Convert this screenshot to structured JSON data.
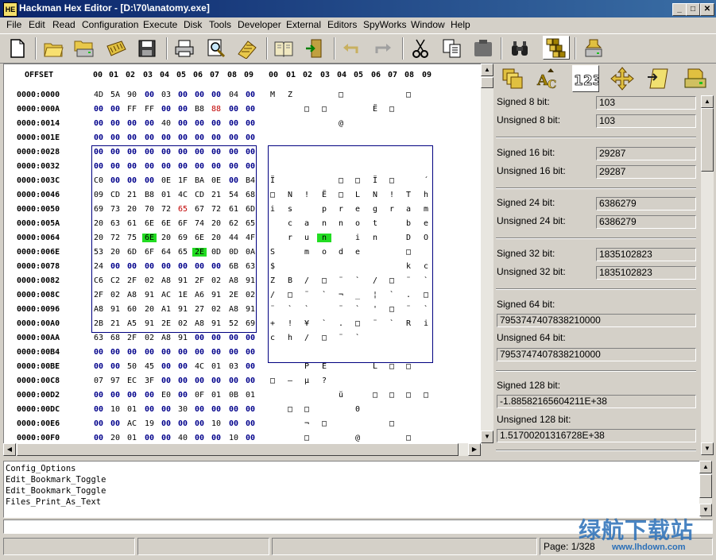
{
  "window": {
    "title": "Hackman Hex Editor - [D:\\70\\anatomy.exe]",
    "app_icon_text": "HE"
  },
  "menu": [
    "File",
    "Edit",
    "Read",
    "Configuration",
    "Execute",
    "Disk",
    "Tools",
    "Developer",
    "External",
    "Editors",
    "SpyWorks",
    "Window",
    "Help"
  ],
  "toolbar": [
    "new-file-icon",
    "open-folder-icon",
    "open-drive-icon",
    "open-memory-icon",
    "save-icon",
    "print-icon",
    "find-icon",
    "calculator-icon",
    "bookmark-book-icon",
    "exit-door-icon",
    "undo-icon",
    "redo-icon",
    "cut-icon",
    "copy-icon",
    "paste-icon",
    "binoculars-icon",
    "tiles-icon",
    "disk-info-icon"
  ],
  "hex": {
    "offset_header": "OFFSET",
    "col_headers": [
      "00",
      "01",
      "02",
      "03",
      "04",
      "05",
      "06",
      "07",
      "08",
      "09"
    ],
    "rows": [
      {
        "off": "0000:0000",
        "b": [
          "4D",
          "5A",
          "90",
          "00",
          "03",
          "00",
          "00",
          "00",
          "04",
          "00"
        ],
        "c": [
          "M",
          "Z",
          "",
          "",
          "□",
          "",
          "",
          "",
          "□",
          ""
        ]
      },
      {
        "off": "0000:000A",
        "b": [
          "00",
          "00",
          "FF",
          "FF",
          "00",
          "00",
          "B8",
          "88",
          "00",
          "00"
        ],
        "c": [
          "",
          "",
          "□",
          "□",
          "",
          "",
          "Ë",
          "□",
          "",
          ""
        ]
      },
      {
        "off": "0000:0014",
        "b": [
          "00",
          "00",
          "00",
          "00",
          "40",
          "00",
          "00",
          "00",
          "00",
          "00"
        ],
        "c": [
          "",
          "",
          "",
          "",
          "@",
          "",
          "",
          "",
          "",
          ""
        ]
      },
      {
        "off": "0000:001E",
        "b": [
          "00",
          "00",
          "00",
          "00",
          "00",
          "00",
          "00",
          "00",
          "00",
          "00"
        ],
        "c": [
          "",
          "",
          "",
          "",
          "",
          "",
          "",
          "",
          "",
          ""
        ]
      },
      {
        "off": "0000:0028",
        "b": [
          "00",
          "00",
          "00",
          "00",
          "00",
          "00",
          "00",
          "00",
          "00",
          "00"
        ],
        "c": [
          "",
          "",
          "",
          "",
          "",
          "",
          "",
          "",
          "",
          ""
        ]
      },
      {
        "off": "0000:0032",
        "b": [
          "00",
          "00",
          "00",
          "00",
          "00",
          "00",
          "00",
          "00",
          "00",
          "00"
        ],
        "c": [
          "",
          "",
          "",
          "",
          "",
          "",
          "",
          "",
          "",
          ""
        ]
      },
      {
        "off": "0000:003C",
        "b": [
          "C0",
          "00",
          "00",
          "00",
          "0E",
          "1F",
          "BA",
          "0E",
          "00",
          "B4"
        ],
        "c": [
          "Ï",
          "",
          "",
          "",
          "□",
          "□",
          "Ï",
          "□",
          "",
          "´"
        ]
      },
      {
        "off": "0000:0046",
        "b": [
          "09",
          "CD",
          "21",
          "B8",
          "01",
          "4C",
          "CD",
          "21",
          "54",
          "68"
        ],
        "c": [
          "□",
          "N",
          "!",
          "Ë",
          "□",
          "L",
          "N",
          "!",
          "T",
          "h"
        ]
      },
      {
        "off": "0000:0050",
        "b": [
          "69",
          "73",
          "20",
          "70",
          "72",
          "65",
          "67",
          "72",
          "61",
          "6D"
        ],
        "c": [
          "i",
          "s",
          "",
          "p",
          "r",
          "e",
          "g",
          "r",
          "a",
          "m"
        ]
      },
      {
        "off": "0000:005A",
        "b": [
          "20",
          "63",
          "61",
          "6E",
          "6E",
          "6F",
          "74",
          "20",
          "62",
          "65"
        ],
        "c": [
          "",
          "c",
          "a",
          "n",
          "n",
          "o",
          "t",
          "",
          "b",
          "e"
        ]
      },
      {
        "off": "0000:0064",
        "b": [
          "20",
          "72",
          "75",
          "6E",
          "20",
          "69",
          "6E",
          "20",
          "44",
          "4F"
        ],
        "c": [
          "",
          "r",
          "u",
          "n",
          "",
          "i",
          "n",
          "",
          "D",
          "O"
        ]
      },
      {
        "off": "0000:006E",
        "b": [
          "53",
          "20",
          "6D",
          "6F",
          "64",
          "65",
          "2E",
          "0D",
          "0D",
          "0A"
        ],
        "c": [
          "S",
          "",
          "m",
          "o",
          "d",
          "e",
          "",
          "",
          "□",
          ""
        ]
      },
      {
        "off": "0000:0078",
        "b": [
          "24",
          "00",
          "00",
          "00",
          "00",
          "00",
          "00",
          "00",
          "6B",
          "63"
        ],
        "c": [
          "$",
          "",
          "",
          "",
          "",
          "",
          "",
          "",
          "k",
          "c"
        ]
      },
      {
        "off": "0000:0082",
        "b": [
          "C6",
          "C2",
          "2F",
          "02",
          "A8",
          "91",
          "2F",
          "02",
          "A8",
          "91"
        ],
        "c": [
          "Z",
          "B",
          "/",
          "□",
          "¨",
          "`",
          "/",
          "□",
          "¨",
          "`"
        ]
      },
      {
        "off": "0000:008C",
        "b": [
          "2F",
          "02",
          "A8",
          "91",
          "AC",
          "1E",
          "A6",
          "91",
          "2E",
          "02"
        ],
        "c": [
          "/",
          "□",
          "¨",
          "`",
          "¬",
          "_",
          "¦",
          "`",
          ".",
          "□"
        ]
      },
      {
        "off": "0000:0096",
        "b": [
          "A8",
          "91",
          "60",
          "20",
          "A1",
          "91",
          "27",
          "02",
          "A8",
          "91"
        ],
        "c": [
          "¨",
          "`",
          "`",
          "",
          "¨",
          "`",
          "'",
          "□",
          "¨",
          "`"
        ]
      },
      {
        "off": "0000:00A0",
        "b": [
          "2B",
          "21",
          "A5",
          "91",
          "2E",
          "02",
          "A8",
          "91",
          "52",
          "69"
        ],
        "c": [
          "+",
          "!",
          "¥",
          "`",
          ".",
          "□",
          "¨",
          "`",
          "R",
          "i"
        ]
      },
      {
        "off": "0000:00AA",
        "b": [
          "63",
          "68",
          "2F",
          "02",
          "A8",
          "91",
          "00",
          "00",
          "00",
          "00"
        ],
        "c": [
          "c",
          "h",
          "/",
          "□",
          "¨",
          "`",
          "",
          "",
          "",
          ""
        ]
      },
      {
        "off": "0000:00B4",
        "b": [
          "00",
          "00",
          "00",
          "00",
          "00",
          "00",
          "00",
          "00",
          "00",
          "00"
        ],
        "c": [
          "",
          "",
          "",
          "",
          "",
          "",
          "",
          "",
          "",
          ""
        ]
      },
      {
        "off": "0000:00BE",
        "b": [
          "00",
          "00",
          "50",
          "45",
          "00",
          "00",
          "4C",
          "01",
          "03",
          "00"
        ],
        "c": [
          "",
          "",
          "P",
          "E",
          "",
          "",
          "L",
          "□",
          "□",
          ""
        ]
      },
      {
        "off": "0000:00C8",
        "b": [
          "07",
          "97",
          "EC",
          "3F",
          "00",
          "00",
          "00",
          "00",
          "00",
          "00"
        ],
        "c": [
          "□",
          "—",
          "µ",
          "?",
          "",
          "",
          "",
          "",
          "",
          ""
        ]
      },
      {
        "off": "0000:00D2",
        "b": [
          "00",
          "00",
          "00",
          "00",
          "E0",
          "00",
          "0F",
          "01",
          "0B",
          "01"
        ],
        "c": [
          "",
          "",
          "",
          "",
          "ŭ",
          "",
          "□",
          "□",
          "□",
          "□"
        ]
      },
      {
        "off": "0000:00DC",
        "b": [
          "00",
          "10",
          "01",
          "00",
          "00",
          "30",
          "00",
          "00",
          "00",
          "00"
        ],
        "c": [
          "",
          "□",
          "□",
          "",
          "",
          "0",
          "",
          "",
          "",
          ""
        ]
      },
      {
        "off": "0000:00E6",
        "b": [
          "00",
          "00",
          "AC",
          "19",
          "00",
          "00",
          "00",
          "10",
          "00",
          "00"
        ],
        "c": [
          "",
          "",
          "¬",
          "□",
          "",
          "",
          "",
          "□",
          "",
          ""
        ]
      },
      {
        "off": "0000:00F0",
        "b": [
          "00",
          "20",
          "01",
          "00",
          "00",
          "40",
          "00",
          "00",
          "10",
          "00"
        ],
        "c": [
          "",
          "",
          "□",
          "",
          "",
          "@",
          "",
          "",
          "□",
          ""
        ]
      }
    ]
  },
  "values": {
    "signed8_label": "Signed 8 bit:",
    "signed8": "103",
    "unsigned8_label": "Unsigned 8 bit:",
    "unsigned8": "103",
    "signed16_label": "Signed 16 bit:",
    "signed16": "29287",
    "unsigned16_label": "Unsigned 16 bit:",
    "unsigned16": "29287",
    "signed24_label": "Signed 24 bit:",
    "signed24": "6386279",
    "unsigned24_label": "Unsigned 24 bit:",
    "unsigned24": "6386279",
    "signed32_label": "Signed 32 bit:",
    "signed32": "1835102823",
    "unsigned32_label": "Unsigned 32 bit:",
    "unsigned32": "1835102823",
    "signed64_label": "Signed 64 bit:",
    "signed64": "7953747407838210000",
    "unsigned64_label": "Unsigned 64 bit:",
    "unsigned64": "7953747407838210000",
    "signed128_label": "Signed 128 bit:",
    "signed128": "-1.88582165604211E+38",
    "unsigned128_label": "Unsigned 128 bit:",
    "unsigned128": "1.51700201316728E+38"
  },
  "log": [
    "Config_Options",
    "Edit_Bookmark_Toggle",
    "Edit_Bookmark_Toggle",
    "Files_Print_As_Text"
  ],
  "status": {
    "page": "Page: 1/328"
  },
  "watermark": {
    "text": "绿航下载站",
    "url": "www.lhdown.com"
  },
  "colors": {
    "zero_byte": "#00008b",
    "highlight": "#22dd22",
    "changed": "#c00000",
    "title_start": "#0a246a",
    "title_end": "#3a6ea5"
  }
}
